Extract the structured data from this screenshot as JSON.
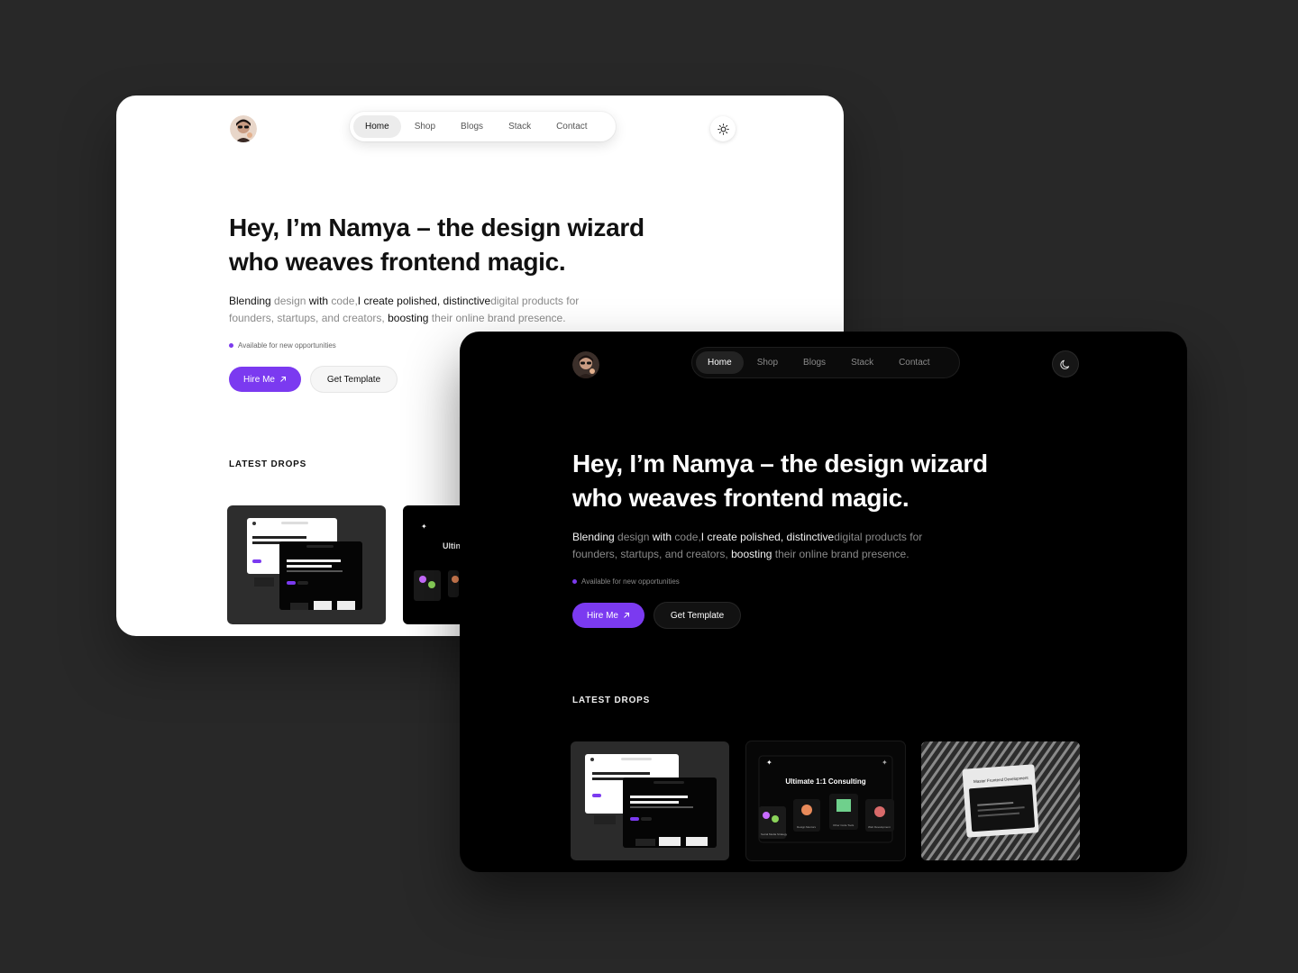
{
  "nav": {
    "items": [
      "Home",
      "Shop",
      "Blogs",
      "Stack",
      "Contact"
    ],
    "active": "Home"
  },
  "hero": {
    "title_line1": "Hey, I’m Namya – the design wizard",
    "title_line2": "who weaves frontend magic.",
    "sub": {
      "w1": "Blending",
      "w2": " design ",
      "w3": "with",
      "w4": " code,",
      "w5": "I create polished, distinctive",
      "w6": "digital products for",
      "w7": "founders, startups, and creators, ",
      "w8": "boosting",
      "w9": " their online brand presence."
    },
    "availability": "Available for new opportunities",
    "hire_label": "Hire Me",
    "hire_icon": "arrow-up-right-icon",
    "template_label": "Get Template"
  },
  "latest": {
    "title": "LATEST DROPS",
    "cards": [
      {
        "caption": "Hey, I’m Namya – the design wizard who weaves frontend magic."
      },
      {
        "caption": "Ultimate 1:1 Consulting",
        "tiles": [
          "Social Media Strategy",
          "Design Mentors",
          "Other Code Tools",
          "Web Development"
        ]
      },
      {
        "caption": "Master Frontend Development"
      }
    ]
  },
  "theme": {
    "light_icon": "sun-icon",
    "dark_icon": "moon-icon"
  },
  "colors": {
    "accent": "#7b3af0",
    "page_bg": "#282828",
    "light_window": "#ffffff",
    "dark_window": "#000000"
  }
}
